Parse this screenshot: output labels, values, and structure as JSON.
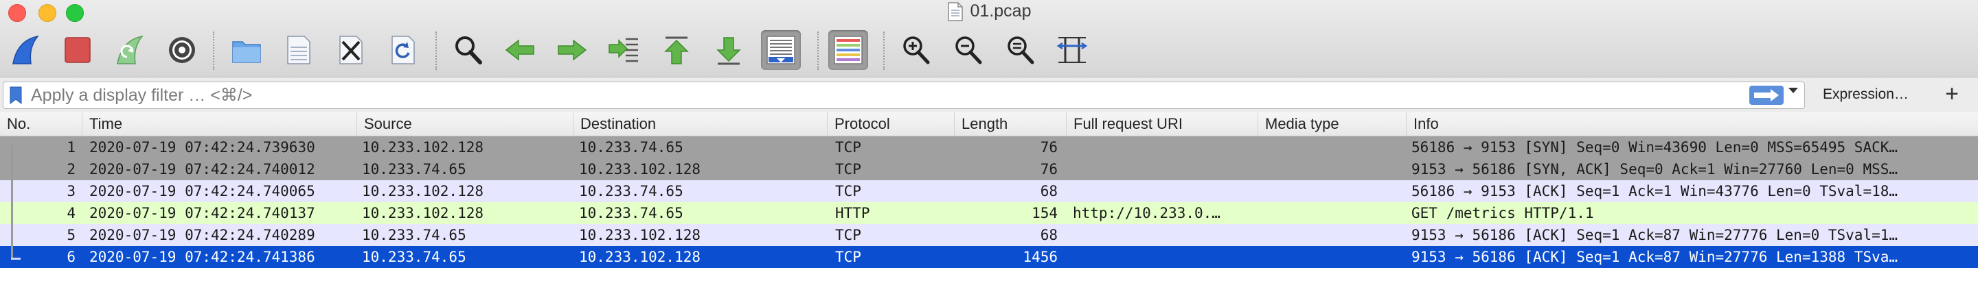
{
  "window": {
    "title": "01.pcap"
  },
  "toolbar": {
    "buttons": [
      {
        "name": "start-capture-icon"
      },
      {
        "name": "stop-capture-icon"
      },
      {
        "name": "restart-capture-icon"
      },
      {
        "name": "capture-options-icon"
      },
      {
        "name": "open-file-icon"
      },
      {
        "name": "save-file-icon"
      },
      {
        "name": "close-file-icon"
      },
      {
        "name": "reload-file-icon"
      },
      {
        "name": "find-packet-icon"
      },
      {
        "name": "go-back-icon"
      },
      {
        "name": "go-forward-icon"
      },
      {
        "name": "go-to-packet-icon"
      },
      {
        "name": "go-first-icon"
      },
      {
        "name": "go-last-icon"
      },
      {
        "name": "autoscroll-icon"
      },
      {
        "name": "colorize-icon"
      },
      {
        "name": "zoom-in-icon"
      },
      {
        "name": "zoom-out-icon"
      },
      {
        "name": "normal-size-icon"
      },
      {
        "name": "resize-columns-icon"
      }
    ]
  },
  "filter": {
    "placeholder": "Apply a display filter … <⌘/>",
    "value": "",
    "expression_label": "Expression…",
    "add_label": "+"
  },
  "columns": [
    "No.",
    "Time",
    "Source",
    "Destination",
    "Protocol",
    "Length",
    "Full request URI",
    "Media type",
    "Info"
  ],
  "packets": [
    {
      "no": "1",
      "time": "2020-07-19 07:42:24.739630",
      "source": "10.233.102.128",
      "destination": "10.233.74.65",
      "protocol": "TCP",
      "length": "76",
      "uri": "",
      "media": "",
      "info": "56186 → 9153 [SYN] Seq=0 Win=43690 Len=0 MSS=65495 SACK…"
    },
    {
      "no": "2",
      "time": "2020-07-19 07:42:24.740012",
      "source": "10.233.74.65",
      "destination": "10.233.102.128",
      "protocol": "TCP",
      "length": "76",
      "uri": "",
      "media": "",
      "info": "9153 → 56186 [SYN, ACK] Seq=0 Ack=1 Win=27760 Len=0 MSS…"
    },
    {
      "no": "3",
      "time": "2020-07-19 07:42:24.740065",
      "source": "10.233.102.128",
      "destination": "10.233.74.65",
      "protocol": "TCP",
      "length": "68",
      "uri": "",
      "media": "",
      "info": "56186 → 9153 [ACK] Seq=1 Ack=1 Win=43776 Len=0 TSval=18…"
    },
    {
      "no": "4",
      "time": "2020-07-19 07:42:24.740137",
      "source": "10.233.102.128",
      "destination": "10.233.74.65",
      "protocol": "HTTP",
      "length": "154",
      "uri": "http://10.233.0.…",
      "media": "",
      "info": "GET /metrics HTTP/1.1"
    },
    {
      "no": "5",
      "time": "2020-07-19 07:42:24.740289",
      "source": "10.233.74.65",
      "destination": "10.233.102.128",
      "protocol": "TCP",
      "length": "68",
      "uri": "",
      "media": "",
      "info": "9153 → 56186 [ACK] Seq=1 Ack=87 Win=27776 Len=0 TSval=1…"
    },
    {
      "no": "6",
      "time": "2020-07-19 07:42:24.741386",
      "source": "10.233.74.65",
      "destination": "10.233.102.128",
      "protocol": "TCP",
      "length": "1456",
      "uri": "",
      "media": "",
      "info": "9153 → 56186 [ACK] Seq=1 Ack=87 Win=27776 Len=1388 TSva…"
    }
  ],
  "row_colors": {
    "syn": "#a0a0a0",
    "tcp": "#e7e6ff",
    "http": "#e4ffc7",
    "selected": "#0b4fd0",
    "selected_text": "#ffffff"
  },
  "selected_row": 6
}
